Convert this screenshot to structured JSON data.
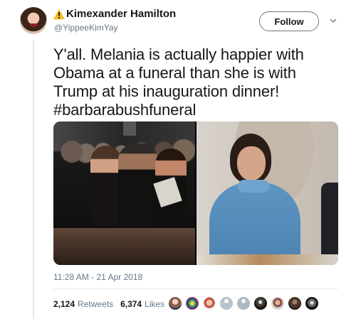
{
  "author": {
    "display_name": "Kimexander Hamilton",
    "name_prefix_icon": "warning-icon",
    "handle": "@YippeeKimYay"
  },
  "follow_button": {
    "label": "Follow"
  },
  "tweet": {
    "text": "Y'all. Melania is actually happier with\nObama at a funeral than she is with\nTrump at his inauguration dinner!\n#barbarabushfuneral",
    "timestamp": "11:28 AM - 21 Apr 2018"
  },
  "stats": {
    "retweets": "2,124",
    "retweets_label": "Retweets",
    "likes": "6,374",
    "likes_label": "Likes"
  },
  "colors": {
    "text": "#14171a",
    "secondary_text": "#657786",
    "warning": "#f6bf26",
    "divider": "#e1e8ed"
  }
}
